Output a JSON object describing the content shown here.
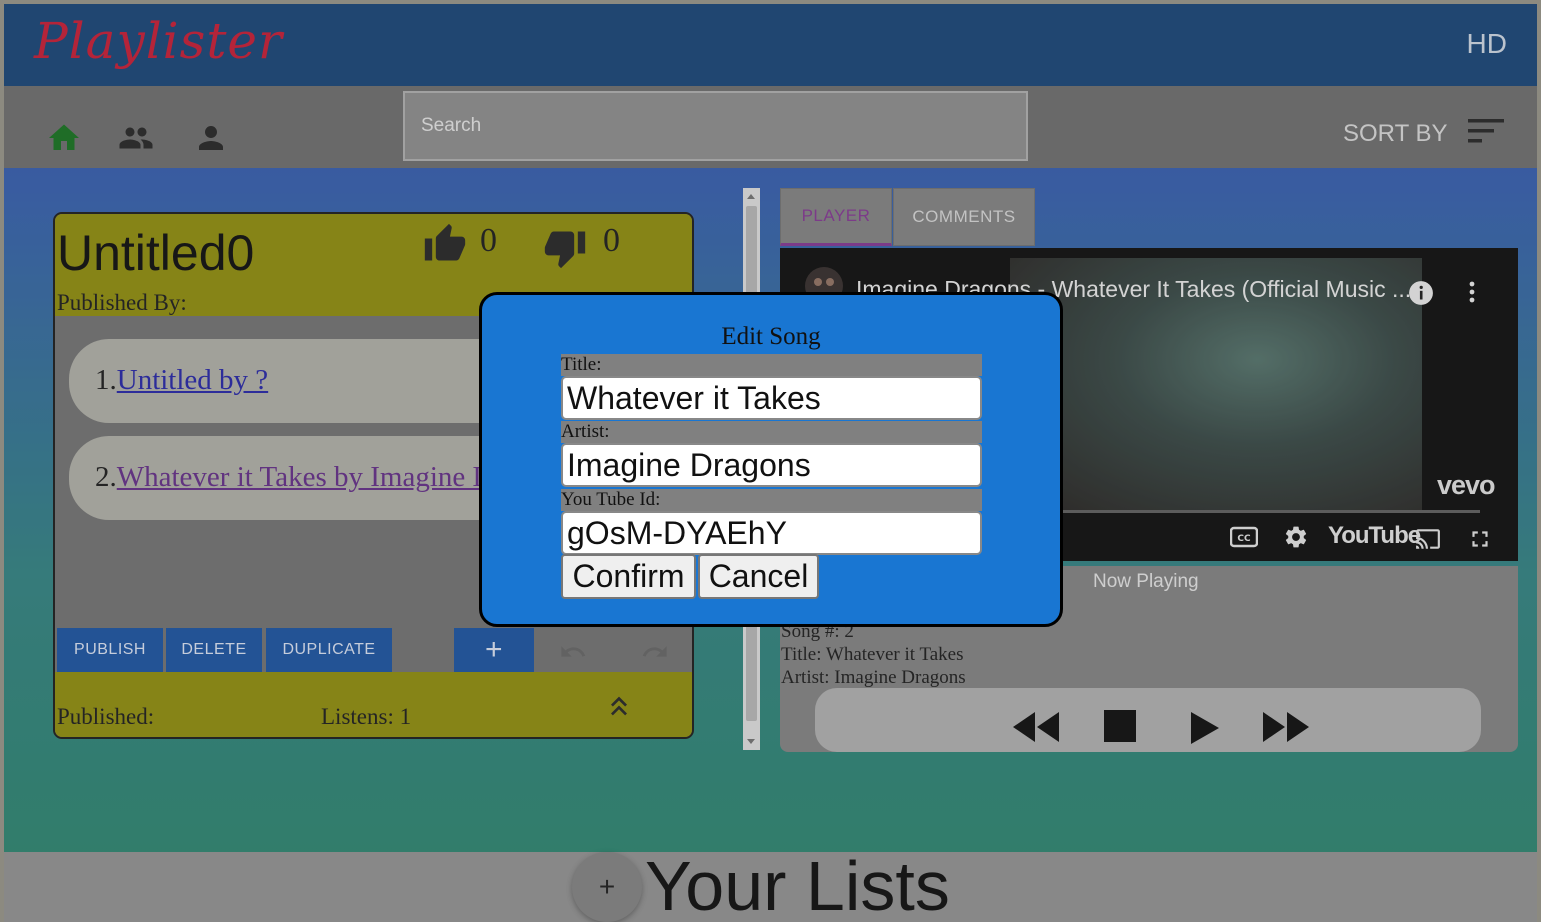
{
  "app": {
    "logo": "Playlister",
    "hd_label": "HD"
  },
  "toolbar": {
    "search_placeholder": "Search",
    "sort_label": "SORT BY"
  },
  "playlist": {
    "name": "Untitled0",
    "published_by": "Published By:",
    "likes": "0",
    "dislikes": "0",
    "songs": [
      {
        "num": "1.",
        "text": "Untitled by ?"
      },
      {
        "num": "2.",
        "text": "Whatever it Takes by Imagine Dragons"
      }
    ],
    "buttons": {
      "publish": "PUBLISH",
      "delete": "DELETE",
      "duplicate": "DUPLICATE",
      "add": "+"
    },
    "published": "Published:",
    "listens": "Listens: 1"
  },
  "player": {
    "tabs": [
      "PLAYER",
      "COMMENTS"
    ],
    "video_title": "Imagine Dragons - Whatever It Takes (Official Music ...",
    "vevo": "vevo",
    "youtube": "YouTube",
    "now_playing": "Now Playing",
    "song_num": "Song #: 2",
    "title": "Title: Whatever it Takes",
    "artist": "Artist: Imagine Dragons"
  },
  "bottom": {
    "add_label": "+",
    "your_lists": "Your Lists"
  },
  "modal": {
    "title": "Edit Song",
    "title_label": "Title:",
    "title_value": "Whatever it Takes",
    "artist_label": "Artist:",
    "artist_value": "Imagine Dragons",
    "ytid_label": "You Tube Id:",
    "ytid_value": "gOsM-DYAEhY",
    "confirm": "Confirm",
    "cancel": "Cancel"
  },
  "colors": {
    "accent_active_tab": "#7c2c8c",
    "home_icon": "#0a6a14",
    "logo": "#c0102a",
    "modal_bg": "#1976d2",
    "card_header": "#888500"
  }
}
